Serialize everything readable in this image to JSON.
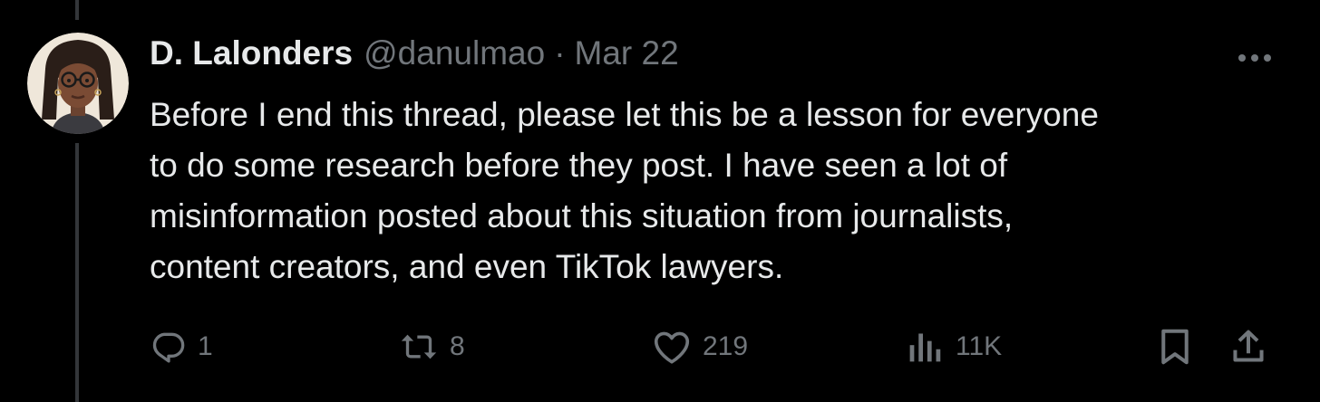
{
  "tweet": {
    "author": {
      "display_name": "D. Lalonders",
      "handle": "@danulmao"
    },
    "separator": "·",
    "date": "Mar 22",
    "text": "Before I end this thread, please let this be a lesson for everyone\nto do some research before they post. I have seen a lot of\nmisinformation posted about this situation from journalists,\ncontent creators, and even TikTok lawyers.",
    "actions": {
      "reply_count": "1",
      "retweet_count": "8",
      "like_count": "219",
      "view_count": "11K"
    },
    "icons": {
      "reply": "reply-icon",
      "retweet": "retweet-icon",
      "like": "heart-icon",
      "views": "views-icon",
      "bookmark": "bookmark-icon",
      "share": "share-icon",
      "more": "more-icon"
    }
  },
  "colors": {
    "background": "#000000",
    "primary_text": "#e7e9ea",
    "secondary_text": "#71767b",
    "thread_line": "#333639"
  }
}
